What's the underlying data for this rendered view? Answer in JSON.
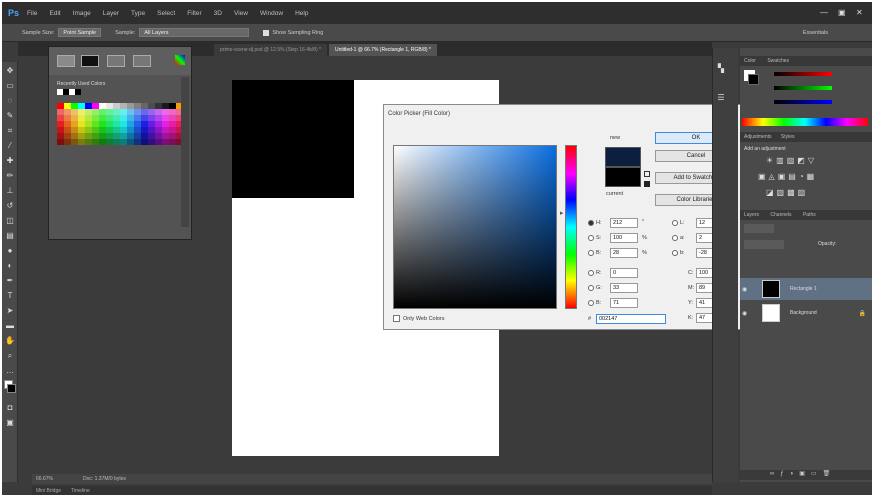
{
  "app": {
    "logo": "Ps"
  },
  "menu": [
    "File",
    "Edit",
    "Image",
    "Layer",
    "Type",
    "Select",
    "Filter",
    "3D",
    "View",
    "Window",
    "Help"
  ],
  "window_controls": [
    "—",
    "▣",
    "✕"
  ],
  "options": {
    "sample_size_label": "Sample Size:",
    "sample_size_value": "Point Sample",
    "sample_label": "Sample:",
    "sample_value": "All Layers",
    "show_ring_label": "Show Sampling Ring",
    "essentials": "Essentials"
  },
  "tabs": [
    {
      "label": "prime-scene-dj.psd @ 12.5% (Step 16.4b/8) *"
    },
    {
      "label": "Untitled-1 @ 66.7% (Rectangle 1, RGB/8) *"
    }
  ],
  "swatches": {
    "title": "Recently Used Colors",
    "colors": [
      "#ff0000",
      "#ffff00",
      "#00ff00",
      "#00ffff",
      "#0000ff",
      "#ff00ff",
      "#ffffff",
      "#e6e6e6",
      "#cccccc",
      "#b3b3b3",
      "#999999",
      "#808080",
      "#666666",
      "#4d4d4d",
      "#333333",
      "#1a1a1a",
      "#000000",
      "#f4a000"
    ]
  },
  "dialog": {
    "title": "Color Picker (Fill Color)",
    "ok": "OK",
    "cancel": "Cancel",
    "add_swatches": "Add to Swatches",
    "libraries": "Color Libraries",
    "new_label": "new",
    "current_label": "current",
    "only_web": "Only Web Colors",
    "H": {
      "label": "H:",
      "value": "212",
      "unit": "°"
    },
    "S": {
      "label": "S:",
      "value": "100",
      "unit": "%"
    },
    "B": {
      "label": "B:",
      "value": "28",
      "unit": "%"
    },
    "R": {
      "label": "R:",
      "value": "0"
    },
    "G": {
      "label": "G:",
      "value": "33"
    },
    "Bl": {
      "label": "B:",
      "value": "71"
    },
    "L": {
      "label": "L:",
      "value": "12"
    },
    "a": {
      "label": "a:",
      "value": "2"
    },
    "b": {
      "label": "b:",
      "value": "-28"
    },
    "C": {
      "label": "C:",
      "value": "100",
      "unit": "%"
    },
    "M": {
      "label": "M:",
      "value": "89",
      "unit": "%"
    },
    "Y": {
      "label": "Y:",
      "value": "41",
      "unit": "%"
    },
    "K": {
      "label": "K:",
      "value": "47",
      "unit": "%"
    },
    "hex_label": "#",
    "hex_value": "002147",
    "new_color": "#0c1f3e",
    "current_color": "#000000"
  },
  "right_panel": {
    "color_tab": "Color",
    "swatches_tab": "Swatches",
    "adjustments_tab": "Adjustments",
    "styles_tab": "Styles",
    "add_adjustment": "Add an adjustment",
    "layers_tab": "Layers",
    "channels_tab": "Channels",
    "paths_tab": "Paths",
    "opacity_label": "Opacity:",
    "layers": [
      {
        "name": "Rectangle 1"
      },
      {
        "name": "Background"
      }
    ]
  },
  "status": {
    "zoom": "66.67%",
    "doc": "Doc: 1.37M/0 bytes"
  },
  "bottom": {
    "mini_bridge": "Mini Bridge",
    "timeline": "Timeline"
  }
}
